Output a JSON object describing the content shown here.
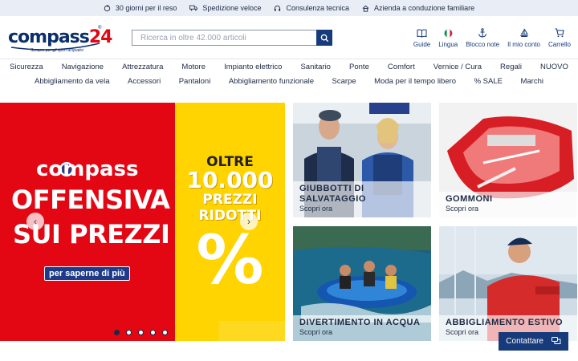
{
  "topbar": {
    "items": [
      {
        "icon": "rotate-icon",
        "label": "30 giorni per il reso"
      },
      {
        "icon": "truck-icon",
        "label": "Spedizione veloce"
      },
      {
        "icon": "headset-icon",
        "label": "Consulenza tecnica"
      },
      {
        "icon": "house-icon",
        "label": "Azienda a conduzione familiare"
      }
    ]
  },
  "header": {
    "logo_text": "compass",
    "logo_number": "24",
    "logo_tagline": "Sempre per gli sport acquatici",
    "logo_reg": "®",
    "search_placeholder": "Ricerca in oltre 42.000 articoli",
    "icons": [
      {
        "name": "guide-icon",
        "label": "Guide"
      },
      {
        "name": "flag-it-icon",
        "label": "Lingua"
      },
      {
        "name": "anchor-icon",
        "label": "Blocco note"
      },
      {
        "name": "sailboat-icon",
        "label": "Il mio conto"
      },
      {
        "name": "cart-icon",
        "label": "Carrello"
      }
    ]
  },
  "nav": {
    "row1": [
      "Sicurezza",
      "Navigazione",
      "Attrezzatura",
      "Motore",
      "Impianto elettrico",
      "Sanitario",
      "Ponte",
      "Comfort",
      "Vernice / Cura",
      "Regali",
      "NUOVO"
    ],
    "row2": [
      "Abbigliamento da vela",
      "Accessori",
      "Pantaloni",
      "Abbigliamento funzionale",
      "Scarpe",
      "Moda per il tempo libero",
      "% SALE",
      "Marchi"
    ]
  },
  "hero": {
    "brand": "compass",
    "line1": "OFFENSIVA",
    "line2": "SUI PREZZI",
    "cta": "per saperne di più",
    "oltre": "OLTRE",
    "big": "10.000",
    "prezzi": "PREZZI",
    "ridotti": "RIDOTTI",
    "pct": "%",
    "slides": 5,
    "active_slide": 1
  },
  "tiles": [
    {
      "title1": "GIUBBOTTI DI",
      "title2": "SALVATAGGIO",
      "sub": "Scopri ora"
    },
    {
      "title1": "GOMMONI",
      "sub": "Scopri ora"
    },
    {
      "title1": "DIVERTIMENTO IN ACQUA",
      "sub": "Scopri ora"
    },
    {
      "title1": "ABBIGLIAMENTO ESTIVO",
      "sub": "Scopri ora"
    }
  ],
  "contact": {
    "label": "Contattare"
  },
  "colors": {
    "brand_blue": "#173a7a",
    "promo_red": "#e30613",
    "promo_yellow": "#ffd400"
  }
}
